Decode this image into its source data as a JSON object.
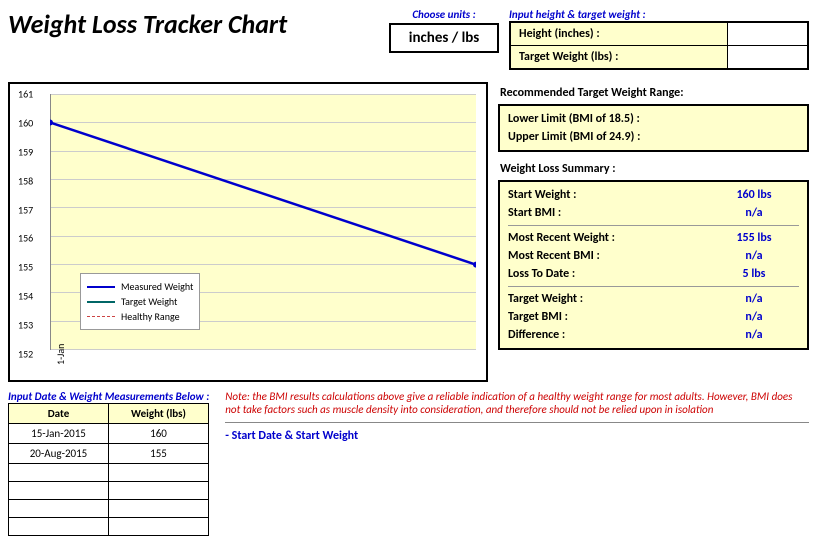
{
  "title": "Weight Loss Tracker Chart",
  "units": {
    "choose_label": "Choose units :",
    "value": "inches / lbs"
  },
  "input_ht": {
    "heading": "Input height & target weight :",
    "height_label": "Height (inches) :",
    "target_label": "Target Weight (lbs) :",
    "height_value": "",
    "target_value": ""
  },
  "recommended": {
    "heading": "Recommended Target Weight Range:",
    "lower_label": "Lower Limit (BMI of 18.5) :",
    "upper_label": "Upper Limit (BMI of 24.9) :",
    "lower_value": "",
    "upper_value": ""
  },
  "summary": {
    "heading": "Weight Loss Summary :",
    "rows": [
      {
        "label": "Start Weight :",
        "value": "160 lbs"
      },
      {
        "label": "Start BMI :",
        "value": "n/a"
      },
      {
        "label": "Most Recent Weight :",
        "value": "155 lbs"
      },
      {
        "label": "Most Recent BMI :",
        "value": "n/a"
      },
      {
        "label": "Loss To Date :",
        "value": "5 lbs"
      },
      {
        "label": "Target Weight :",
        "value": "n/a"
      },
      {
        "label": "Target BMI :",
        "value": "n/a"
      },
      {
        "label": "Difference :",
        "value": "n/a"
      }
    ]
  },
  "data_entry": {
    "heading": "Input Date & Weight Measurements Below :",
    "col_date": "Date",
    "col_weight": "Weight (lbs)",
    "rows": [
      {
        "date": "15-Jan-2015",
        "weight": "160"
      },
      {
        "date": "20-Aug-2015",
        "weight": "155"
      },
      {
        "date": "",
        "weight": ""
      },
      {
        "date": "",
        "weight": ""
      },
      {
        "date": "",
        "weight": ""
      },
      {
        "date": "",
        "weight": ""
      }
    ]
  },
  "note": "Note: the BMI results calculations above give a reliable indication of a healthy weight range for most adults. However, BMI does not take factors such as muscle density into consideration, and therefore should not be relied upon in isolation",
  "start_label": "- Start Date & Start Weight",
  "chart_data": {
    "type": "line",
    "title": "",
    "xlabel": "",
    "ylabel": "",
    "ylim": [
      152,
      161
    ],
    "y_ticks": [
      152,
      153,
      154,
      155,
      156,
      157,
      158,
      159,
      160,
      161
    ],
    "x_ticks": [
      "1-Jan"
    ],
    "series": [
      {
        "name": "Measured Weight",
        "color": "#0000cc",
        "x": [
          "15-Jan-2015",
          "20-Aug-2015"
        ],
        "values": [
          160,
          155
        ]
      },
      {
        "name": "Target Weight",
        "color": "#006666",
        "x": [],
        "values": []
      },
      {
        "name": "Healthy Range",
        "color": "#cc4444",
        "style": "dashed",
        "x": [],
        "values": []
      }
    ],
    "legend": [
      "Measured Weight",
      "Target Weight",
      "Healthy Range"
    ]
  }
}
